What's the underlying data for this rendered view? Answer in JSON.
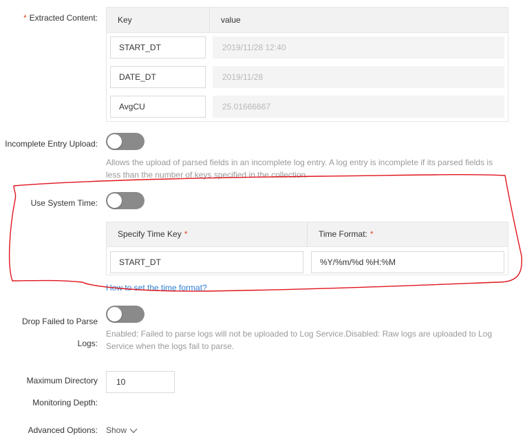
{
  "extracted_content": {
    "label": "Extracted Content:",
    "required_mark": "*",
    "columns": {
      "key": "Key",
      "value": "value"
    },
    "rows": [
      {
        "key": "START_DT",
        "value": "2019/11/28 12:40"
      },
      {
        "key": "DATE_DT",
        "value": "2019/11/28"
      },
      {
        "key": "AvgCU",
        "value": "25.01666667"
      }
    ]
  },
  "incomplete_entry": {
    "label": "Incomplete Entry Upload:",
    "enabled": false,
    "help_line1": "Allows the upload of parsed fields in an incomplete log entry. A log entry is incomplete if its parsed fields is",
    "help_line2": "less than the number of keys specified in the collection."
  },
  "system_time": {
    "label": "Use System Time:",
    "enabled": false,
    "columns": {
      "time_key": "Specify Time Key",
      "time_format": "Time Format:",
      "required_mark": "*"
    },
    "time_key_value": "START_DT",
    "time_format_value": "%Y/%m/%d %H:%M",
    "help_link": "How to set the time format?"
  },
  "drop_failed": {
    "label_line1": "Drop Failed to Parse",
    "label_line2": "Logs:",
    "enabled": false,
    "help_line1": "Enabled: Failed to parse logs will not be uploaded to Log Service.Disabled: Raw logs are uploaded to Log",
    "help_line2": "Service when the logs fail to parse."
  },
  "max_depth": {
    "label_line1": "Maximum Directory",
    "label_line2": "Monitoring Depth:",
    "value": "10"
  },
  "advanced": {
    "label": "Advanced Options:",
    "toggle_text": "Show",
    "icon": "chevron-down-icon"
  },
  "annotation": {
    "color": "#e0141c"
  }
}
